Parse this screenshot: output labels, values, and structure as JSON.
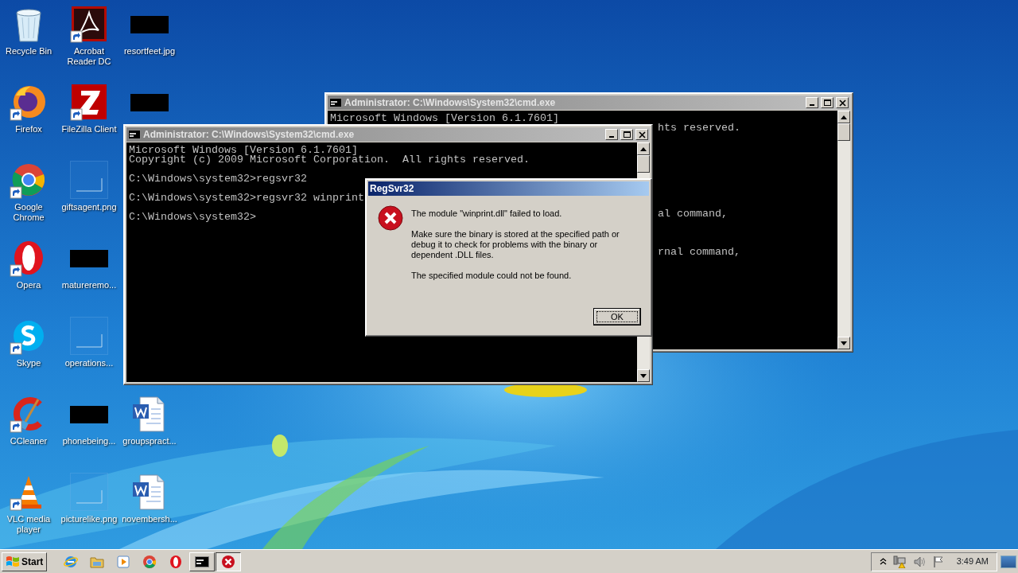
{
  "desktop_icons": [
    {
      "label": "Recycle Bin",
      "kind": "recycle-bin",
      "shortcut": false
    },
    {
      "label": "Firefox",
      "kind": "firefox",
      "shortcut": true
    },
    {
      "label": "Google Chrome",
      "kind": "chrome",
      "shortcut": true
    },
    {
      "label": "Opera",
      "kind": "opera",
      "shortcut": true
    },
    {
      "label": "Skype",
      "kind": "skype",
      "shortcut": true
    },
    {
      "label": "CCleaner",
      "kind": "ccleaner",
      "shortcut": true
    },
    {
      "label": "VLC media player",
      "kind": "vlc",
      "shortcut": true
    },
    {
      "label": "Acrobat Reader DC",
      "kind": "acrobat",
      "shortcut": true
    },
    {
      "label": "FileZilla Client",
      "kind": "filezilla",
      "shortcut": true
    },
    {
      "label": "giftsagent.png",
      "kind": "blank-image",
      "shortcut": false
    },
    {
      "label": "matureremo...",
      "kind": "redacted-image",
      "shortcut": false
    },
    {
      "label": "operations...",
      "kind": "blank-image",
      "shortcut": false
    },
    {
      "label": "phonebeing...",
      "kind": "redacted-image",
      "shortcut": false
    },
    {
      "label": "picturelike.png",
      "kind": "blank-image",
      "shortcut": false
    },
    {
      "label": "resortfeet.jpg",
      "kind": "redacted-image",
      "shortcut": false
    },
    {
      "kind": "redacted-image",
      "shortcut": false
    },
    {
      "kind": "covered"
    },
    {
      "kind": "covered"
    },
    {
      "kind": "covered"
    },
    {
      "label": "groupspract...",
      "kind": "word-doc",
      "shortcut": false
    },
    {
      "label": "novembersh...",
      "kind": "word-doc",
      "shortcut": false
    }
  ],
  "back_console": {
    "title": "Administrator: C:\\Windows\\System32\\cmd.exe",
    "first_line": "Microsoft Windows [Version 6.1.7601]",
    "fragments": [
      "hts reserved.",
      "al command,",
      "rnal command,"
    ]
  },
  "front_console": {
    "title": "Administrator: C:\\Windows\\System32\\cmd.exe",
    "lines": [
      "Microsoft Windows [Version 6.1.7601]",
      "Copyright (c) 2009 Microsoft Corporation.  All rights reserved.",
      "C:\\Windows\\system32>regsvr32",
      "C:\\Windows\\system32>regsvr32 winprint",
      "C:\\Windows\\system32>"
    ]
  },
  "dialog": {
    "title": "RegSvr32",
    "paragraphs": [
      "The module \"winprint.dll\" failed to load.",
      "Make sure the binary is stored at the specified path or debug it to check for problems with the binary or dependent .DLL files.",
      "The specified module could not be found."
    ],
    "button": "OK"
  },
  "taskbar": {
    "start": "Start",
    "items": [
      {
        "kind": "ie",
        "running": false,
        "selected": false
      },
      {
        "kind": "folder",
        "running": false,
        "selected": false
      },
      {
        "kind": "media",
        "running": false,
        "selected": false
      },
      {
        "kind": "chrome",
        "running": false,
        "selected": false
      },
      {
        "kind": "opera",
        "running": false,
        "selected": false
      },
      {
        "kind": "cmd",
        "running": true,
        "selected": false
      },
      {
        "kind": "error",
        "running": true,
        "selected": true
      }
    ],
    "time": "3:49 AM"
  }
}
